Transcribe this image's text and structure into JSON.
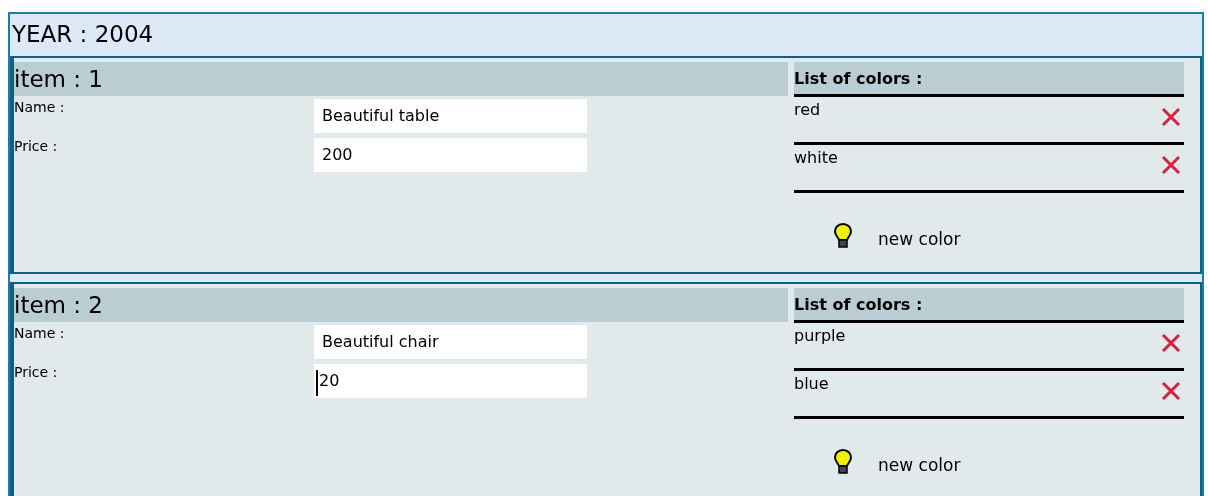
{
  "year": {
    "title": "YEAR : 2004"
  },
  "items": [
    {
      "title": "item : 1",
      "fields": [
        {
          "label": "Name :",
          "value": "Beautiful table",
          "focused": false
        },
        {
          "label": "Price :",
          "value": "200",
          "focused": false
        }
      ],
      "colors_title": "List of colors :",
      "colors": [
        "red",
        "white"
      ],
      "add_label": "new color"
    },
    {
      "title": "item : 2",
      "fields": [
        {
          "label": "Name :",
          "value": "Beautiful chair",
          "focused": false
        },
        {
          "label": "Price :",
          "value": "20",
          "focused": true
        }
      ],
      "colors_title": "List of colors :",
      "colors": [
        "purple",
        "blue"
      ],
      "add_label": "new color"
    }
  ]
}
